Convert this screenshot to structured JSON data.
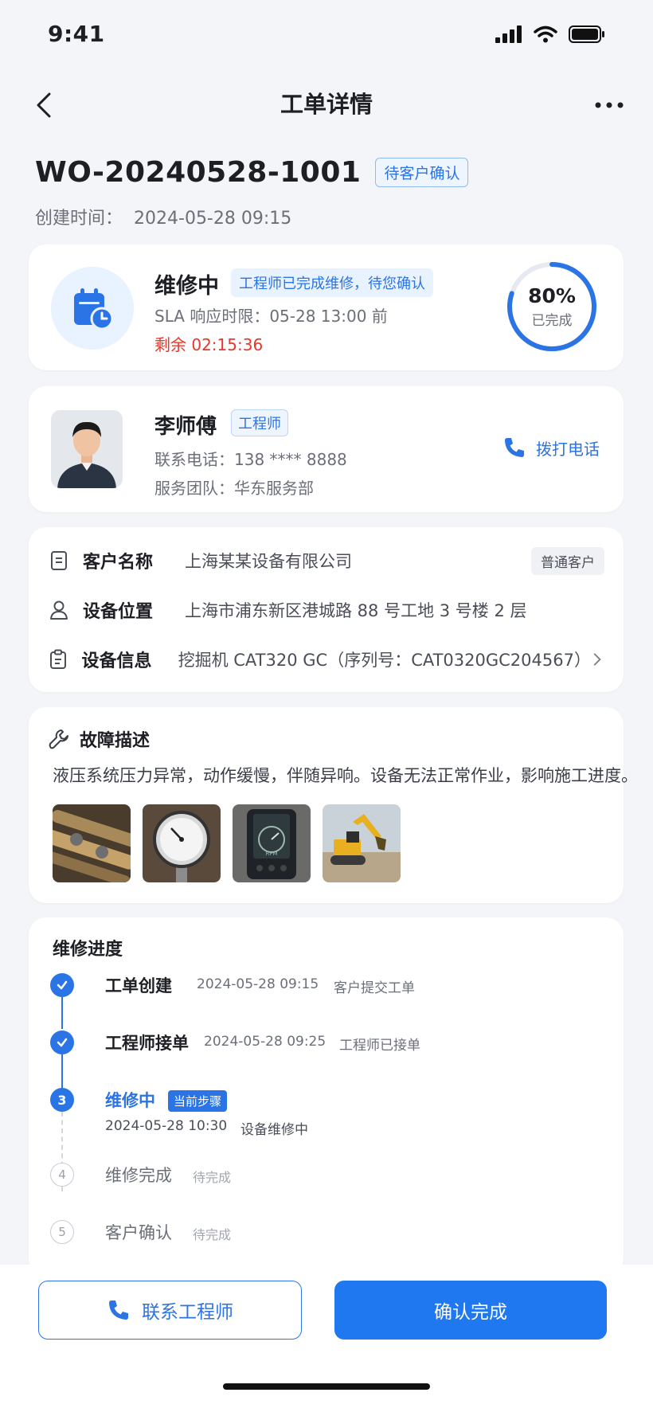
{
  "status_bar": {
    "time": "9:41"
  },
  "nav": {
    "title": "工单详情"
  },
  "order": {
    "id": "WO-20240528-1001",
    "status_badge": "待客户确认",
    "created_label": "创建时间：",
    "created_value": "2024-05-28 09:15"
  },
  "status_card": {
    "title": "维修中",
    "tag": "工程师已完成维修，待您确认",
    "sla": "SLA 响应时限：05-28 13:00 前",
    "remaining": "剩余 02:15:36",
    "progress_fraction": 0.8,
    "progress_text": "80%",
    "progress_label": "已完成"
  },
  "engineer": {
    "name": "李师傅",
    "role": "工程师",
    "phone": "联系电话：138 **** 8888",
    "team": "服务团队：华东服务部",
    "call_label": "拨打电话"
  },
  "info": {
    "customer_label": "客户名称",
    "customer_value": "上海某某设备有限公司",
    "customer_tag": "普通客户",
    "location_label": "设备位置",
    "location_value": "上海市浦东新区港城路 88 号工地 3 号楼 2 层",
    "device_label": "设备信息",
    "device_value": "挖掘机 CAT320 GC（序列号：CAT0320GC204567）"
  },
  "fault": {
    "title": "故障描述",
    "description": "液压系统压力异常，动作缓慢，伴随异响。设备无法正常作业，影响施工进度。",
    "gauge_text": "RPM"
  },
  "progress": {
    "title": "维修进度",
    "steps": [
      {
        "num": "1",
        "name": "工单创建",
        "time": "2024-05-28 09:15",
        "note": "客户提交工单"
      },
      {
        "num": "2",
        "name": "工程师接单",
        "time": "2024-05-28 09:25",
        "note": "工程师已接单"
      },
      {
        "num": "3",
        "name": "维修中",
        "tag": "当前步骤",
        "time": "2024-05-28 10:30",
        "note": "设备维修中"
      },
      {
        "num": "4",
        "name": "维修完成",
        "note": "待完成"
      },
      {
        "num": "5",
        "name": "客户确认",
        "note": "待完成"
      }
    ]
  },
  "actions": {
    "contact": "联系工程师",
    "confirm": "确认完成"
  },
  "colors": {
    "primary": "#2b74e6",
    "danger": "#e5372b",
    "background": "#f4f5f8"
  }
}
